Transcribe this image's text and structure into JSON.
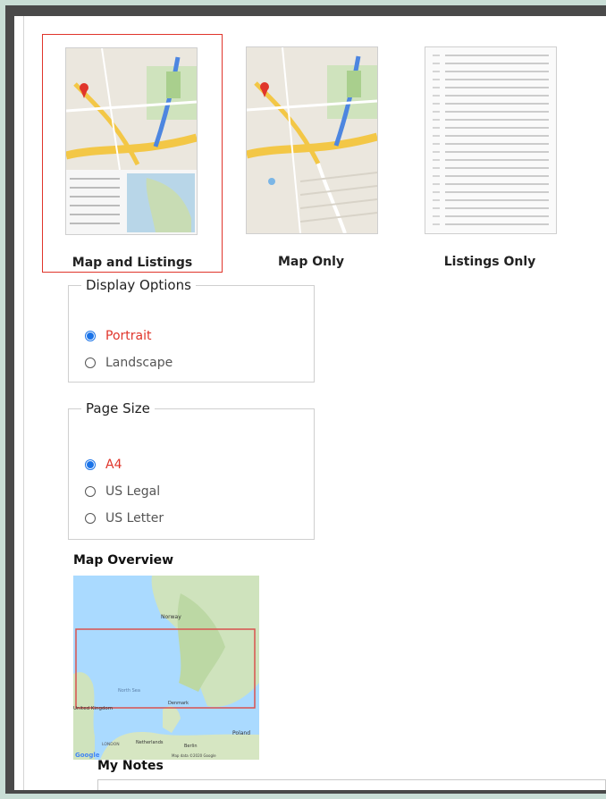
{
  "layouts": [
    {
      "label": "Map and Listings",
      "selected": true,
      "icon": "map-with-listings-thumbnail"
    },
    {
      "label": "Map Only",
      "selected": false,
      "icon": "map-thumbnail"
    },
    {
      "label": "Listings Only",
      "selected": false,
      "icon": "listings-thumbnail"
    }
  ],
  "display_options": {
    "legend": "Display Options",
    "options": [
      {
        "label": "Portrait",
        "checked": true
      },
      {
        "label": "Landscape",
        "checked": false
      }
    ]
  },
  "page_size": {
    "legend": "Page Size",
    "options": [
      {
        "label": "A4",
        "checked": true
      },
      {
        "label": "US Legal",
        "checked": false
      },
      {
        "label": "US Letter",
        "checked": false
      }
    ]
  },
  "map_overview": {
    "title": "Map Overview",
    "labels": {
      "norway": "Norway",
      "north_sea": "North Sea",
      "united_kingdom": "United\nKingdom",
      "denmark": "Denmark",
      "netherlands": "Netherlands",
      "berlin": "Berlin",
      "poland": "Poland",
      "london": "LONDON",
      "google": "Google",
      "map_data": "Map data ©2020 Google"
    }
  },
  "notes": {
    "title": "My Notes"
  },
  "colors": {
    "accent_red": "#e0352b",
    "radio_blue": "#1a73e8",
    "background": "#c9ded6",
    "frame": "#4a4a4a"
  }
}
